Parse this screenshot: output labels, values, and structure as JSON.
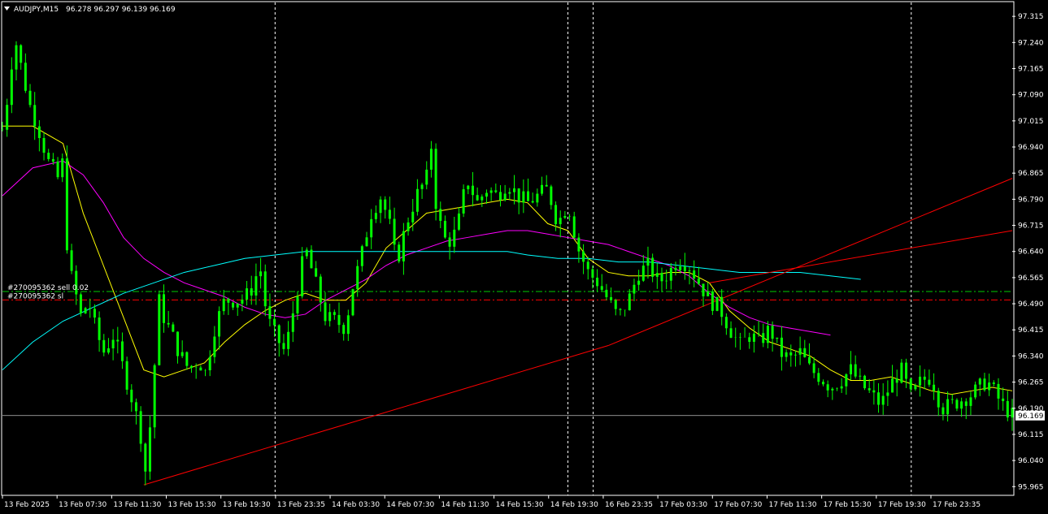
{
  "header": {
    "symbol_timeframe": "AUDJPY,M15",
    "ohlc": "96.278 96.297 96.139 96.169"
  },
  "colors": {
    "background": "#000000",
    "frame": "#ffffff",
    "candle": "#00ff00",
    "ma_fast": "#ffff00",
    "ma_mid": "#ff00ff",
    "ma_slow": "#00ffff",
    "trendline": "#ff0000",
    "entry_line": "#00cc00",
    "sl_line": "#ff0000",
    "period_separator": "#ffffff"
  },
  "orders": {
    "entry_label": "#270095362 sell 0.02",
    "sl_label": "#270095362 sl"
  },
  "current_price_label": "96.169",
  "chart_data": {
    "type": "candlestick",
    "title": "AUDJPY,M15",
    "ylim": [
      95.94,
      97.355
    ],
    "y_ticks": [
      "97.315",
      "97.240",
      "97.165",
      "97.090",
      "97.015",
      "96.940",
      "96.865",
      "96.790",
      "96.715",
      "96.640",
      "96.565",
      "96.490",
      "96.415",
      "96.340",
      "96.265",
      "96.190",
      "96.115",
      "96.040",
      "95.965"
    ],
    "x_ticks": [
      "13 Feb 2025",
      "13 Feb 07:30",
      "13 Feb 11:30",
      "13 Feb 15:30",
      "13 Feb 19:30",
      "13 Feb 23:35",
      "14 Feb 03:30",
      "14 Feb 07:30",
      "14 Feb 11:30",
      "14 Feb 15:30",
      "14 Feb 19:30",
      "16 Feb 23:35",
      "17 Feb 03:30",
      "17 Feb 07:30",
      "17 Feb 11:30",
      "17 Feb 15:30",
      "17 Feb 19:30",
      "17 Feb 23:35"
    ],
    "entry_price": 96.525,
    "sl_price": 96.501,
    "current_price": 96.169,
    "price_path": [
      [
        0,
        96.99
      ],
      [
        0.006,
        97.1
      ],
      [
        0.012,
        97.26
      ],
      [
        0.02,
        97.15
      ],
      [
        0.028,
        97.05
      ],
      [
        0.035,
        97.0
      ],
      [
        0.045,
        96.9
      ],
      [
        0.055,
        96.85
      ],
      [
        0.06,
        96.9
      ],
      [
        0.065,
        96.6
      ],
      [
        0.07,
        96.55
      ],
      [
        0.078,
        96.45
      ],
      [
        0.085,
        96.5
      ],
      [
        0.092,
        96.42
      ],
      [
        0.1,
        96.35
      ],
      [
        0.11,
        96.4
      ],
      [
        0.12,
        96.3
      ],
      [
        0.13,
        96.2
      ],
      [
        0.138,
        96.1
      ],
      [
        0.142,
        96.0
      ],
      [
        0.148,
        96.2
      ],
      [
        0.155,
        96.5
      ],
      [
        0.16,
        96.45
      ],
      [
        0.168,
        96.4
      ],
      [
        0.175,
        96.35
      ],
      [
        0.185,
        96.3
      ],
      [
        0.195,
        96.33
      ],
      [
        0.2,
        96.28
      ],
      [
        0.21,
        96.42
      ],
      [
        0.22,
        96.5
      ],
      [
        0.235,
        96.5
      ],
      [
        0.245,
        96.52
      ],
      [
        0.255,
        96.6
      ],
      [
        0.262,
        96.45
      ],
      [
        0.27,
        96.4
      ],
      [
        0.28,
        96.35
      ],
      [
        0.29,
        96.5
      ],
      [
        0.3,
        96.65
      ],
      [
        0.31,
        96.55
      ],
      [
        0.32,
        96.45
      ],
      [
        0.33,
        96.44
      ],
      [
        0.34,
        96.42
      ],
      [
        0.345,
        96.52
      ],
      [
        0.355,
        96.62
      ],
      [
        0.365,
        96.75
      ],
      [
        0.375,
        96.8
      ],
      [
        0.385,
        96.7
      ],
      [
        0.39,
        96.6
      ],
      [
        0.4,
        96.72
      ],
      [
        0.41,
        96.8
      ],
      [
        0.42,
        96.85
      ],
      [
        0.425,
        96.95
      ],
      [
        0.43,
        96.75
      ],
      [
        0.44,
        96.66
      ],
      [
        0.45,
        96.7
      ],
      [
        0.46,
        96.85
      ],
      [
        0.47,
        96.78
      ],
      [
        0.48,
        96.82
      ],
      [
        0.49,
        96.8
      ],
      [
        0.5,
        96.84
      ],
      [
        0.51,
        96.8
      ],
      [
        0.52,
        96.78
      ],
      [
        0.53,
        96.8
      ],
      [
        0.54,
        96.82
      ],
      [
        0.55,
        96.72
      ],
      [
        0.56,
        96.78
      ],
      [
        0.57,
        96.65
      ],
      [
        0.58,
        96.58
      ],
      [
        0.59,
        96.55
      ],
      [
        0.6,
        96.5
      ],
      [
        0.61,
        96.45
      ],
      [
        0.62,
        96.5
      ],
      [
        0.63,
        96.58
      ],
      [
        0.64,
        96.6
      ],
      [
        0.65,
        96.55
      ],
      [
        0.66,
        96.58
      ],
      [
        0.67,
        96.62
      ],
      [
        0.68,
        96.6
      ],
      [
        0.69,
        96.55
      ],
      [
        0.7,
        96.5
      ],
      [
        0.71,
        96.48
      ],
      [
        0.72,
        96.42
      ],
      [
        0.73,
        96.37
      ],
      [
        0.74,
        96.4
      ],
      [
        0.75,
        96.38
      ],
      [
        0.76,
        96.42
      ],
      [
        0.77,
        96.35
      ],
      [
        0.78,
        96.33
      ],
      [
        0.79,
        96.35
      ],
      [
        0.8,
        96.3
      ],
      [
        0.81,
        96.28
      ],
      [
        0.82,
        96.25
      ],
      [
        0.83,
        96.27
      ],
      [
        0.84,
        96.3
      ],
      [
        0.85,
        96.26
      ],
      [
        0.86,
        96.23
      ],
      [
        0.87,
        96.2
      ],
      [
        0.88,
        96.26
      ],
      [
        0.89,
        96.3
      ],
      [
        0.9,
        96.22
      ],
      [
        0.91,
        96.27
      ],
      [
        0.92,
        96.28
      ],
      [
        0.93,
        96.19
      ],
      [
        0.94,
        96.2
      ],
      [
        0.96,
        96.23
      ],
      [
        0.975,
        96.27
      ],
      [
        0.99,
        96.2
      ],
      [
        1,
        96.17
      ]
    ],
    "ma_fast": [
      [
        0,
        97.0
      ],
      [
        0.03,
        97.0
      ],
      [
        0.06,
        96.95
      ],
      [
        0.08,
        96.75
      ],
      [
        0.1,
        96.6
      ],
      [
        0.12,
        96.45
      ],
      [
        0.14,
        96.3
      ],
      [
        0.16,
        96.28
      ],
      [
        0.18,
        96.3
      ],
      [
        0.2,
        96.32
      ],
      [
        0.22,
        96.38
      ],
      [
        0.24,
        96.43
      ],
      [
        0.26,
        96.47
      ],
      [
        0.28,
        96.5
      ],
      [
        0.3,
        96.52
      ],
      [
        0.32,
        96.5
      ],
      [
        0.34,
        96.5
      ],
      [
        0.36,
        96.55
      ],
      [
        0.38,
        96.65
      ],
      [
        0.4,
        96.7
      ],
      [
        0.42,
        96.75
      ],
      [
        0.44,
        96.76
      ],
      [
        0.46,
        96.77
      ],
      [
        0.48,
        96.78
      ],
      [
        0.5,
        96.79
      ],
      [
        0.52,
        96.78
      ],
      [
        0.54,
        96.72
      ],
      [
        0.56,
        96.7
      ],
      [
        0.58,
        96.62
      ],
      [
        0.6,
        96.58
      ],
      [
        0.62,
        96.57
      ],
      [
        0.64,
        96.57
      ],
      [
        0.66,
        96.58
      ],
      [
        0.68,
        96.58
      ],
      [
        0.7,
        96.55
      ],
      [
        0.72,
        96.47
      ],
      [
        0.74,
        96.42
      ],
      [
        0.76,
        96.38
      ],
      [
        0.78,
        96.36
      ],
      [
        0.8,
        96.34
      ],
      [
        0.82,
        96.3
      ],
      [
        0.84,
        96.27
      ],
      [
        0.86,
        96.27
      ],
      [
        0.88,
        96.28
      ],
      [
        0.9,
        96.26
      ],
      [
        0.92,
        96.24
      ],
      [
        0.94,
        96.23
      ],
      [
        0.96,
        96.24
      ],
      [
        0.98,
        96.25
      ],
      [
        1,
        96.24
      ]
    ],
    "ma_mid": [
      [
        0,
        96.8
      ],
      [
        0.03,
        96.88
      ],
      [
        0.06,
        96.9
      ],
      [
        0.08,
        96.86
      ],
      [
        0.1,
        96.78
      ],
      [
        0.12,
        96.68
      ],
      [
        0.14,
        96.62
      ],
      [
        0.16,
        96.58
      ],
      [
        0.18,
        96.55
      ],
      [
        0.2,
        96.53
      ],
      [
        0.22,
        96.51
      ],
      [
        0.24,
        96.48
      ],
      [
        0.26,
        96.46
      ],
      [
        0.28,
        96.45
      ],
      [
        0.3,
        96.46
      ],
      [
        0.32,
        96.5
      ],
      [
        0.34,
        96.53
      ],
      [
        0.36,
        96.56
      ],
      [
        0.38,
        96.6
      ],
      [
        0.4,
        96.63
      ],
      [
        0.42,
        96.65
      ],
      [
        0.44,
        96.67
      ],
      [
        0.46,
        96.68
      ],
      [
        0.48,
        96.69
      ],
      [
        0.5,
        96.7
      ],
      [
        0.52,
        96.7
      ],
      [
        0.54,
        96.69
      ],
      [
        0.56,
        96.68
      ],
      [
        0.58,
        96.67
      ],
      [
        0.6,
        96.66
      ],
      [
        0.62,
        96.64
      ],
      [
        0.64,
        96.62
      ],
      [
        0.66,
        96.6
      ],
      [
        0.68,
        96.57
      ],
      [
        0.7,
        96.52
      ],
      [
        0.72,
        96.48
      ],
      [
        0.74,
        96.45
      ],
      [
        0.76,
        96.43
      ],
      [
        0.78,
        96.42
      ],
      [
        0.8,
        96.41
      ],
      [
        0.82,
        96.4
      ]
    ],
    "ma_slow": [
      [
        0,
        96.3
      ],
      [
        0.03,
        96.38
      ],
      [
        0.06,
        96.44
      ],
      [
        0.09,
        96.48
      ],
      [
        0.12,
        96.52
      ],
      [
        0.15,
        96.55
      ],
      [
        0.18,
        96.58
      ],
      [
        0.21,
        96.6
      ],
      [
        0.24,
        96.62
      ],
      [
        0.27,
        96.63
      ],
      [
        0.3,
        96.64
      ],
      [
        0.33,
        96.64
      ],
      [
        0.36,
        96.64
      ],
      [
        0.39,
        96.64
      ],
      [
        0.42,
        96.64
      ],
      [
        0.45,
        96.64
      ],
      [
        0.48,
        96.64
      ],
      [
        0.5,
        96.64
      ],
      [
        0.52,
        96.63
      ],
      [
        0.55,
        96.62
      ],
      [
        0.58,
        96.62
      ],
      [
        0.61,
        96.61
      ],
      [
        0.64,
        96.61
      ],
      [
        0.67,
        96.6
      ],
      [
        0.7,
        96.59
      ],
      [
        0.73,
        96.58
      ],
      [
        0.76,
        96.58
      ],
      [
        0.79,
        96.58
      ],
      [
        0.82,
        96.57
      ],
      [
        0.85,
        96.56
      ]
    ],
    "trendlines": [
      {
        "from": [
          0.14,
          95.97
        ],
        "to": [
          0.6,
          96.37
        ]
      },
      {
        "from": [
          0.6,
          96.37
        ],
        "to": [
          1.0,
          96.85
        ]
      },
      {
        "from": [
          0.7,
          96.55
        ],
        "to": [
          1.0,
          96.7
        ]
      }
    ],
    "separators": [
      0.27,
      0.56,
      0.585,
      0.9
    ]
  }
}
